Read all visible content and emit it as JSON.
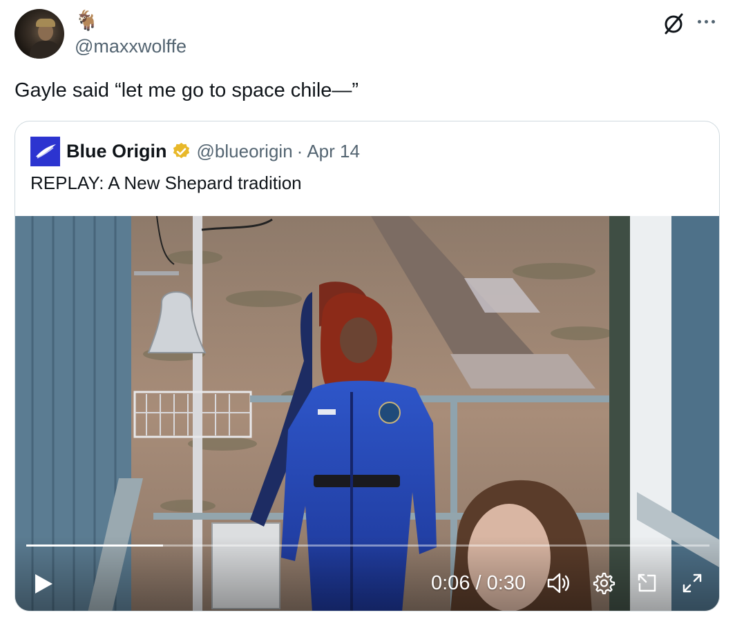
{
  "author": {
    "display_name": "🐐",
    "handle": "@maxxwolffe"
  },
  "tweet": {
    "text": "Gayle said “let me go to space chile—”"
  },
  "quoted_tweet": {
    "author_name": "Blue Origin",
    "handle": "@blueorigin",
    "separator": "·",
    "date": "Apr 14",
    "text": "REPLAY: A New Shepard tradition",
    "verified_color": "#e8b829"
  },
  "video": {
    "current_time": "0:06",
    "time_separator": " / ",
    "duration": "0:30",
    "progress": 0.2
  },
  "icons": [
    "grok-icon",
    "more-icon",
    "verified-badge-icon",
    "play-icon",
    "volume-icon",
    "settings-icon",
    "pip-icon",
    "fullscreen-icon"
  ]
}
